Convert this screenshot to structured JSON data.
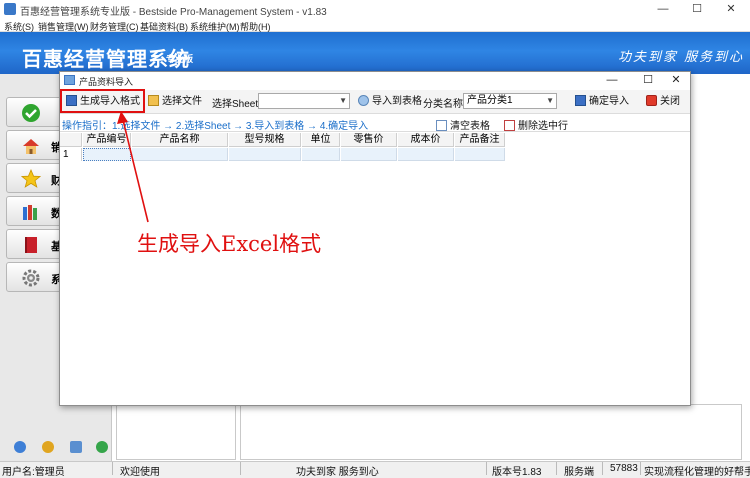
{
  "window": {
    "title": "百惠经营管理系统专业版 - Bestside Pro-Management System  - v1.83",
    "minimize": "—",
    "maximize": "☐",
    "close": "✕"
  },
  "menu": [
    "系统(S)",
    "销售管理(W)",
    "财务管理(C)",
    "基础资料(B)",
    "系统维护(M)",
    "帮助(H)"
  ],
  "banner": {
    "title": "百惠经营管理系统",
    "subtitle": "专业版",
    "slogan": "功夫到家  服务到心"
  },
  "sidebar": {
    "items": [
      {
        "label": "",
        "icon": "check-icon"
      },
      {
        "label": "销",
        "icon": "home-icon"
      },
      {
        "label": "财",
        "icon": "star-icon"
      },
      {
        "label": "数",
        "icon": "books-icon"
      },
      {
        "label": "基",
        "icon": "book-icon"
      },
      {
        "label": "系",
        "icon": "gear-icon"
      }
    ]
  },
  "dialog": {
    "title": "产品资料导入",
    "toolbar": {
      "generate": "生成导入格式",
      "choose_file": "选择文件",
      "choose_sheet_label": "选择Sheet",
      "sheet_value": "",
      "import_to_table": "导入到表格",
      "category_label": "分类名称",
      "category_value": "产品分类1",
      "confirm_import": "确定导入",
      "close": "关闭"
    },
    "guide": {
      "text": "操作指引：1.选择文件  →  2.选择Sheet  →  3.导入到表格  →  4.确定导入",
      "clear_table": "清空表格",
      "delete_row": "删除选中行"
    },
    "grid": {
      "columns": [
        "产品编号",
        "产品名称",
        "型号规格",
        "单位",
        "零售价",
        "成本价",
        "产品备注"
      ],
      "rows": [
        {
          "num": "1"
        }
      ]
    }
  },
  "annotation": {
    "text": "生成导入Excel格式",
    "color": "#e01010"
  },
  "status": {
    "user": "用户名:管理员",
    "welcome": "欢迎使用",
    "motto": "功夫到家 服务到心",
    "version": "版本号1.83",
    "service_label": "服务端",
    "service_value": "57883",
    "tagline": "实现流程化管理的好帮手"
  }
}
